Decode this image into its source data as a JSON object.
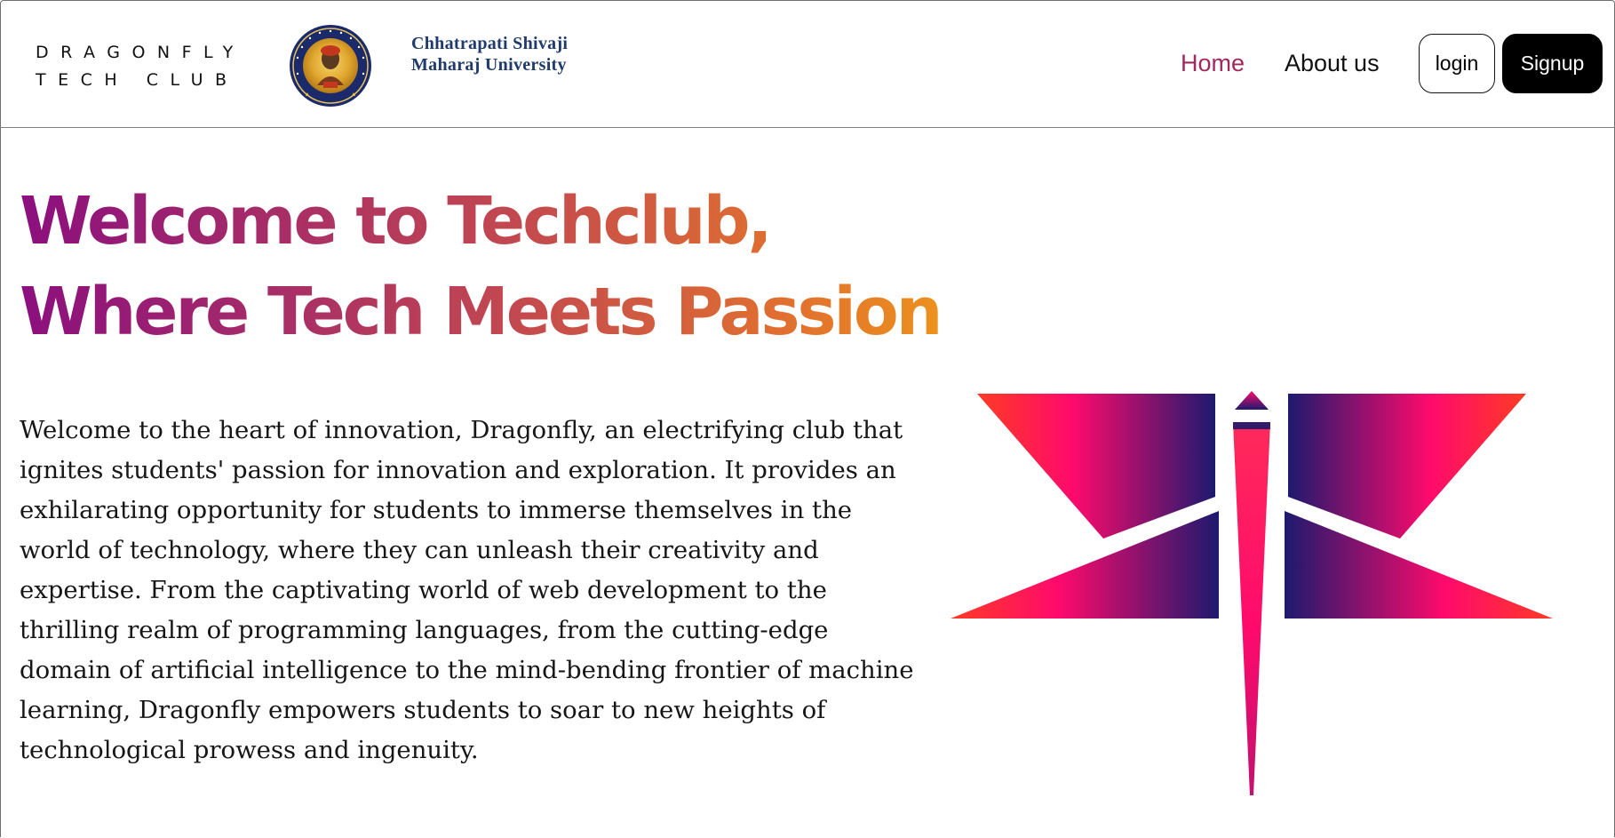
{
  "navbar": {
    "brand_line1": "DRAGONFLY",
    "brand_line2": "TECH CLUB",
    "university_line1": "Chhatrapati Shivaji",
    "university_line2": "Maharaj University",
    "links": {
      "home": "Home",
      "about": "About us"
    },
    "login_label": "login",
    "signup_label": "Signup",
    "active_link_color": "#a1285f"
  },
  "hero": {
    "title_line1": "Welcome to Techclub,",
    "title_line2": "Where Tech Meets Passion",
    "title_gradient": [
      "#8b0f7e",
      "#c44a4e",
      "#ec911e"
    ],
    "paragraph": "Welcome to the heart of innovation, Dragonfly, an electrifying club that ignites students' passion for innovation and exploration. It provides an exhilarating opportunity for students to immerse themselves in the world of technology, where they can unleash their creativity and expertise. From the captivating world of web development to the thrilling realm of programming languages, from the cutting-edge domain of artificial intelligence to the mind-bending frontier of machine learning, Dragonfly empowers students to soar to new heights of technological prowess and ingenuity."
  },
  "illustration": {
    "icon": "dragonfly-icon",
    "colors": [
      "#1d1a6e",
      "#ff0a6c",
      "#ff3b24"
    ]
  }
}
